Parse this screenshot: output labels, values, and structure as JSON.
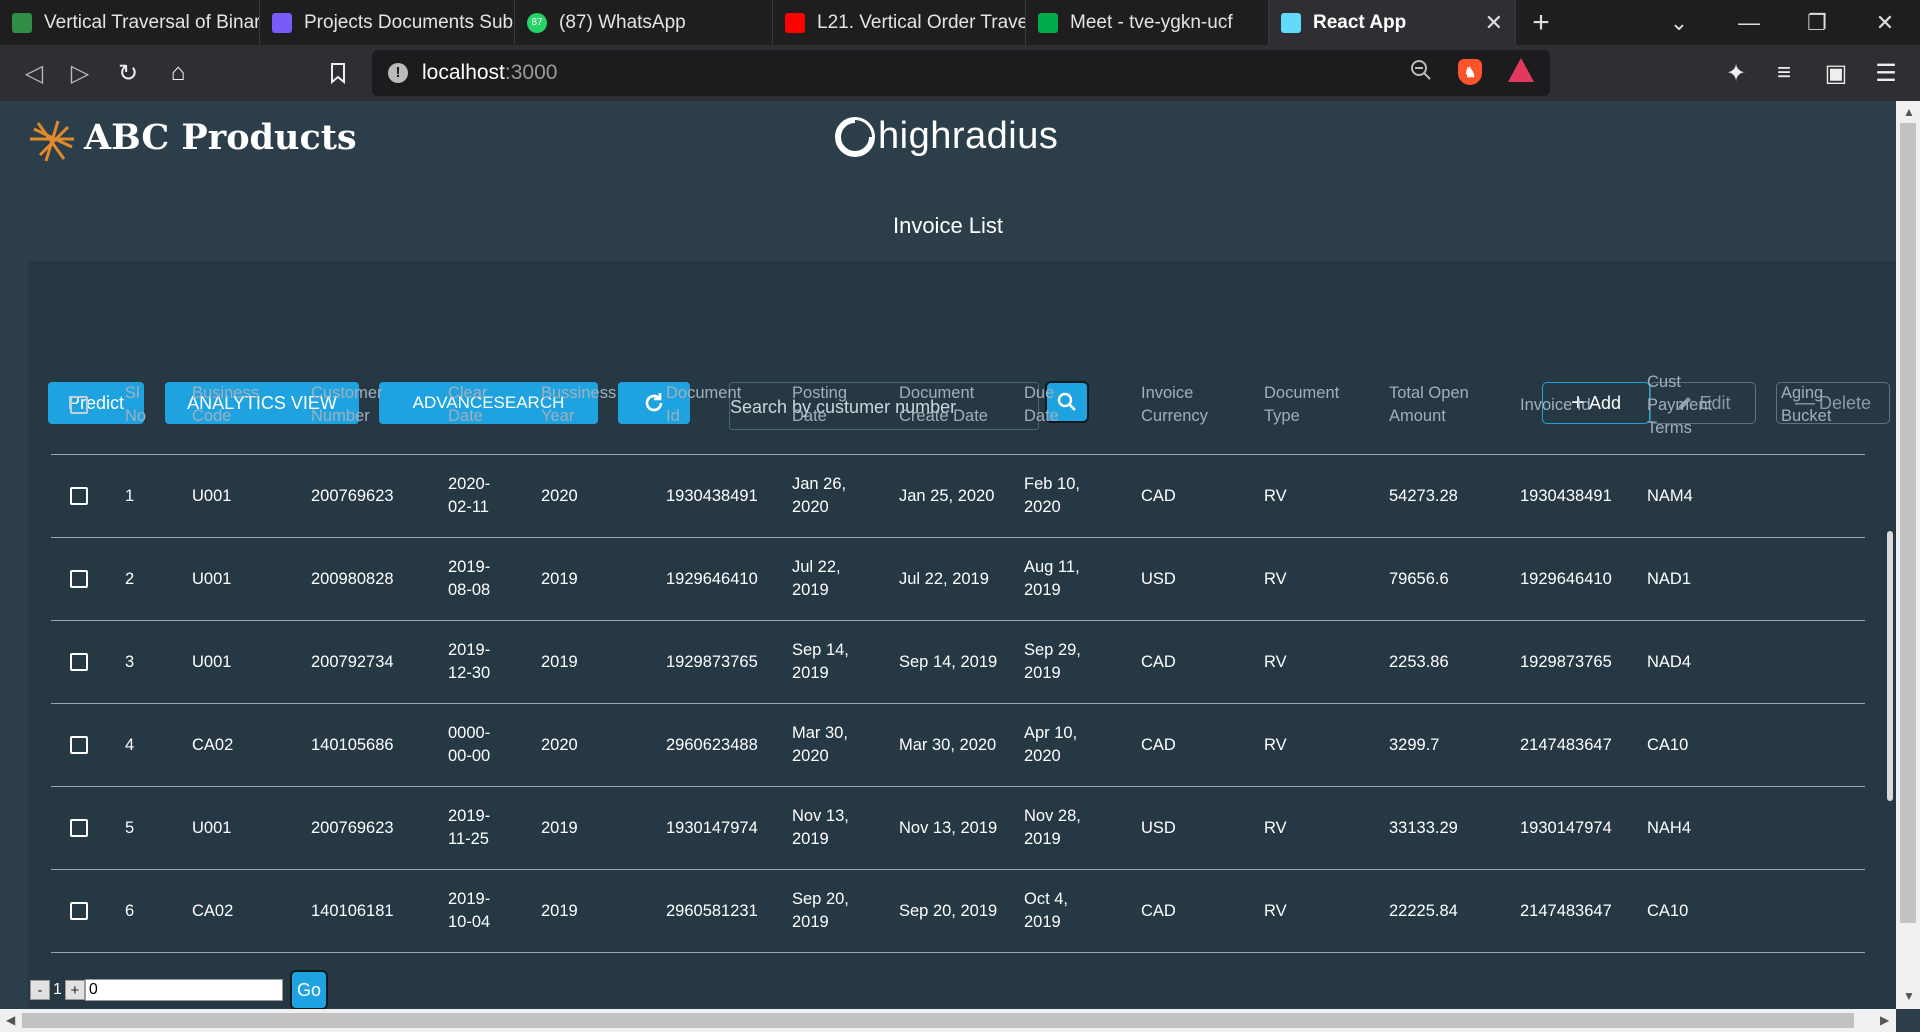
{
  "browser": {
    "tabs": [
      {
        "title": "Vertical Traversal of Binar",
        "icon": "gfg-icon",
        "icon_color": "#2f8d46"
      },
      {
        "title": "Projects Documents Subr",
        "icon": "list-icon",
        "icon_color": "#7a5af8"
      },
      {
        "title": "(87) WhatsApp",
        "icon": "whatsapp-icon",
        "icon_color": "#25d366",
        "badge": "87"
      },
      {
        "title": "L21. Vertical Order Traver",
        "icon": "youtube-icon",
        "icon_color": "#ff0000"
      },
      {
        "title": "Meet - tve-ygkn-ucf",
        "icon": "meet-icon",
        "icon_color": "#00ac47"
      },
      {
        "title": "React App",
        "icon": "react-icon",
        "icon_color": "#61dafb",
        "active": true
      }
    ],
    "url_host": "localhost",
    "url_port": ":3000"
  },
  "header": {
    "brand": "ABC Products",
    "partner_logo": "highradius",
    "title": "Invoice List"
  },
  "toolbar": {
    "predict": "Predict",
    "analytics": "ANALYTICS VIEW",
    "advanced_search": "ADVANCESEARCH",
    "search_placeholder": "Search by custumer number",
    "add": "Add",
    "edit": "Edit",
    "delete": "Delete"
  },
  "table": {
    "columns": [
      [
        "Sl",
        "No"
      ],
      [
        "Business",
        "Code"
      ],
      [
        "Customer",
        "Number"
      ],
      [
        "Clear",
        "Date"
      ],
      [
        "Bussiness",
        "Year"
      ],
      [
        "Document",
        "Id"
      ],
      [
        "Posting",
        "Date"
      ],
      [
        "Document",
        "Create Date"
      ],
      [
        "Due",
        "Date"
      ],
      [
        "Invoice",
        "Currency"
      ],
      [
        "Document",
        "Type"
      ],
      [
        "Total Open",
        "Amount"
      ],
      [
        "Invoice Id"
      ],
      [
        "Cust",
        "Payment",
        "Terms"
      ],
      [
        "Aging",
        "Bucket"
      ]
    ],
    "rows": [
      {
        "cells": [
          [
            "1"
          ],
          [
            "U001"
          ],
          [
            "200769623"
          ],
          [
            "2020-",
            "02-11"
          ],
          [
            "2020"
          ],
          [
            "1930438491"
          ],
          [
            "Jan 26,",
            "2020"
          ],
          [
            "Jan 25, 2020"
          ],
          [
            "Feb 10,",
            "2020"
          ],
          [
            "CAD"
          ],
          [
            "RV"
          ],
          [
            "54273.28"
          ],
          [
            "1930438491"
          ],
          [
            "NAM4"
          ],
          [
            ""
          ]
        ]
      },
      {
        "cells": [
          [
            "2"
          ],
          [
            "U001"
          ],
          [
            "200980828"
          ],
          [
            "2019-",
            "08-08"
          ],
          [
            "2019"
          ],
          [
            "1929646410"
          ],
          [
            "Jul 22,",
            "2019"
          ],
          [
            "Jul 22, 2019"
          ],
          [
            "Aug 11,",
            "2019"
          ],
          [
            "USD"
          ],
          [
            "RV"
          ],
          [
            "79656.6"
          ],
          [
            "1929646410"
          ],
          [
            "NAD1"
          ],
          [
            ""
          ]
        ]
      },
      {
        "cells": [
          [
            "3"
          ],
          [
            "U001"
          ],
          [
            "200792734"
          ],
          [
            "2019-",
            "12-30"
          ],
          [
            "2019"
          ],
          [
            "1929873765"
          ],
          [
            "Sep 14,",
            "2019"
          ],
          [
            "Sep 14, 2019"
          ],
          [
            "Sep 29,",
            "2019"
          ],
          [
            "CAD"
          ],
          [
            "RV"
          ],
          [
            "2253.86"
          ],
          [
            "1929873765"
          ],
          [
            "NAD4"
          ],
          [
            ""
          ]
        ]
      },
      {
        "cells": [
          [
            "4"
          ],
          [
            "CA02"
          ],
          [
            "140105686"
          ],
          [
            "0000-",
            "00-00"
          ],
          [
            "2020"
          ],
          [
            "2960623488"
          ],
          [
            "Mar 30,",
            "2020"
          ],
          [
            "Mar 30, 2020"
          ],
          [
            "Apr 10,",
            "2020"
          ],
          [
            "CAD"
          ],
          [
            "RV"
          ],
          [
            "3299.7"
          ],
          [
            "2147483647"
          ],
          [
            "CA10"
          ],
          [
            ""
          ]
        ]
      },
      {
        "cells": [
          [
            "5"
          ],
          [
            "U001"
          ],
          [
            "200769623"
          ],
          [
            "2019-",
            "11-25"
          ],
          [
            "2019"
          ],
          [
            "1930147974"
          ],
          [
            "Nov 13,",
            "2019"
          ],
          [
            "Nov 13, 2019"
          ],
          [
            "Nov 28,",
            "2019"
          ],
          [
            "USD"
          ],
          [
            "RV"
          ],
          [
            "33133.29"
          ],
          [
            "1930147974"
          ],
          [
            "NAH4"
          ],
          [
            ""
          ]
        ]
      },
      {
        "cells": [
          [
            "6"
          ],
          [
            "CA02"
          ],
          [
            "140106181"
          ],
          [
            "2019-",
            "10-04"
          ],
          [
            "2019"
          ],
          [
            "2960581231"
          ],
          [
            "Sep 20,",
            "2019"
          ],
          [
            "Sep 20, 2019"
          ],
          [
            "Oct 4,",
            "2019"
          ],
          [
            "CAD"
          ],
          [
            "RV"
          ],
          [
            "22225.84"
          ],
          [
            "2147483647"
          ],
          [
            "CA10"
          ],
          [
            ""
          ]
        ]
      }
    ]
  },
  "pagination": {
    "minus": "-",
    "page": "1",
    "plus": "+",
    "input_value": "0",
    "go": "Go"
  }
}
